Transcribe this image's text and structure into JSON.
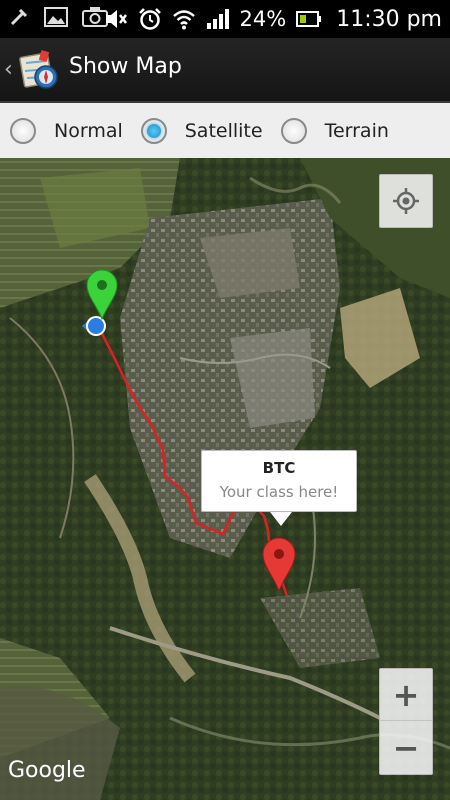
{
  "status_bar": {
    "left_icons": [
      "usb-debug-icon",
      "image-icon",
      "camera-icon"
    ],
    "right_icons": [
      "mute-icon",
      "alarm-icon",
      "wifi-icon",
      "signal-icon",
      "battery-icon"
    ],
    "battery_percent": "24%",
    "time": "11:30 pm"
  },
  "action_bar": {
    "title": "Show Map",
    "up_icon": "chevron-left-icon",
    "app_icon": "map-compass-icon"
  },
  "map_type": {
    "options": [
      {
        "label": "Normal",
        "checked": false
      },
      {
        "label": "Satellite",
        "checked": true
      },
      {
        "label": "Terrain",
        "checked": false
      }
    ],
    "accent": "#33b5e5"
  },
  "map": {
    "view": "satellite",
    "markers": [
      {
        "color": "#2ecc2e",
        "icon": "green-pin-icon"
      },
      {
        "color": "#e53935",
        "icon": "red-pin-icon"
      }
    ],
    "my_location_icon": "my-location-dot-icon",
    "route_color": "#e02020",
    "info_window": {
      "title": "BTC",
      "snippet": "Your class here!"
    },
    "controls": {
      "my_location": "crosshair-icon",
      "zoom_in": "+",
      "zoom_out": "−"
    },
    "attribution": "Google"
  }
}
